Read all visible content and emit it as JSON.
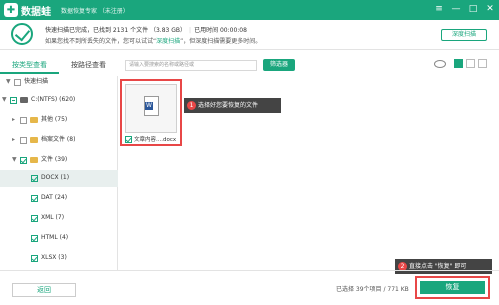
{
  "app": {
    "brand": "数据蛙",
    "subtitle": "数据恢复专家 （未注册）",
    "window_controls": [
      "≡",
      "—",
      "□",
      "✕"
    ]
  },
  "status": {
    "line1_a": "快速扫描已完成，已找到 2131 个文件 （3.83 GB）",
    "line1_b": "已用时间 00:00:08",
    "line2_pre": "如果您找不到所丢失的文件，您可以试试“",
    "line2_link": "深度扫描",
    "line2_post": "”，但深度扫描需要更多时间。",
    "progress": 1
  },
  "header": {
    "deep_scan_button": "深度扫描"
  },
  "tabs": [
    {
      "label": "按类型查看"
    },
    {
      "label": "按路径查看"
    }
  ],
  "search": {
    "placeholder": "请输入要搜索的名称或路径或"
  },
  "toolbar": {
    "filter_button": "筛选器"
  },
  "tree": {
    "items": [
      {
        "label": "快速扫描"
      },
      {
        "label": "C:(NTFS) (620)"
      },
      {
        "label": "其他 (75)"
      },
      {
        "label": "档案文件 (8)"
      },
      {
        "label": "文件 (39)"
      },
      {
        "label": "DOCX (1)"
      },
      {
        "label": "DAT (24)"
      },
      {
        "label": "XML (7)"
      },
      {
        "label": "HTML (4)"
      },
      {
        "label": "XLSX (3)"
      }
    ]
  },
  "file_card": {
    "name": "文章内容....docx",
    "icon_letter": "W"
  },
  "callouts": [
    {
      "badge": "1",
      "text": "选择好您要恢复的文件"
    },
    {
      "badge": "2",
      "text": "直接点击 \"恢复\" 即可"
    }
  ],
  "bottom": {
    "back_button": "返回",
    "info": "已选择 39个项目 / 771 KB",
    "restore_button": "恢复"
  }
}
